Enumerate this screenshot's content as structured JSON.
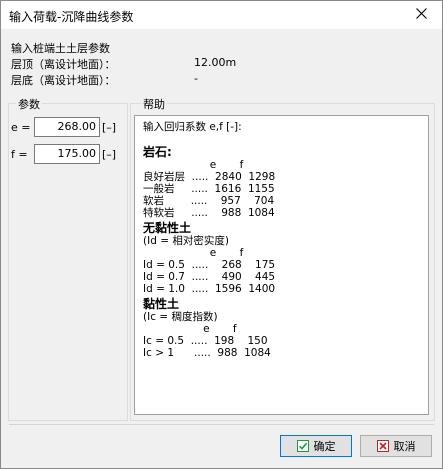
{
  "window": {
    "title": "输入荷载-沉降曲线参数"
  },
  "info": {
    "heading": "输入桩端土土层参数",
    "top_label": "层顶（离设计地面）：",
    "top_value": "12.00m",
    "bottom_label": "层底（离设计地面）：",
    "bottom_value": "-"
  },
  "params": {
    "group_title": "参数",
    "e_label": "e =",
    "e_value": "268.00",
    "e_unit": "[–]",
    "f_label": "f =",
    "f_value": "175.00",
    "f_unit": "[–]"
  },
  "help": {
    "group_title": "帮助",
    "intro": "输入回归系数 e,f [-]:",
    "rock_heading": "岩石:",
    "rock_cols": "                    e       f",
    "rock_rows": [
      "良好岩层  .....  2840  1298",
      "一般岩     .....  1616  1155",
      "软岩        .....    957    704",
      "特软岩     .....    988  1084"
    ],
    "noncohesive_heading": "无黏性土",
    "noncohesive_note": "(Id = 相对密实度)",
    "noncohesive_cols": "                    e       f",
    "noncohesive_rows": [
      "Id = 0.5  .....    268    175",
      "Id = 0.7  .....    490    445",
      "Id = 1.0  .....  1596  1400"
    ],
    "cohesive_heading": "黏性土",
    "cohesive_note": "(Ic = 稠度指数)",
    "cohesive_cols": "                  e       f",
    "cohesive_rows": [
      "Ic = 0.5  .....  198    150",
      "Ic > 1      .....  988  1084"
    ]
  },
  "buttons": {
    "ok_label": "确定",
    "cancel_label": "取消"
  },
  "colors": {
    "ok_icon": "#1a9c3a",
    "cancel_icon": "#c02020",
    "accent": "#0078d7"
  },
  "icons": {
    "close": "close-icon",
    "ok": "check-box-icon",
    "cancel": "x-box-icon"
  }
}
